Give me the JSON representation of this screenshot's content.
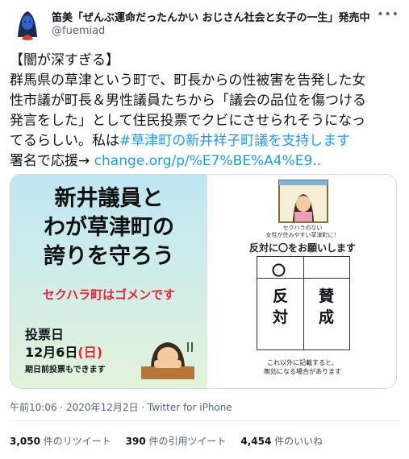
{
  "author": {
    "display_name": "笛美「ぜんぶ運命だったんかい おじさん社会と女子の一生」発売中",
    "handle": "@fuemiad"
  },
  "tweet": {
    "lines": [
      "【闇が深すぎる】",
      "群馬県の草津という町で、町長からの性被害を告発した女",
      "性市議が町長＆男性議員たちから「議会の品位を傷つける",
      "発言をした」として住民投票でクビにさせられそうになっ",
      "てるらしい。私は"
    ],
    "hashtag": "#草津町の新井祥子町議を支持します",
    "sign_prefix": "署名で応援→ ",
    "link": "change.org/p/%E7%BE%A4%E9.."
  },
  "media": {
    "left": {
      "title_1": "新井議員と",
      "title_2": "わが草津町の",
      "title_3": "誇りを守ろう",
      "subtitle": "セクハラ町はゴメンです",
      "vote_label": "投票日",
      "vote_date_prefix": "12月6日",
      "vote_date_day": "(日)",
      "early_vote": "期日前投票もできます"
    },
    "right": {
      "caption_1": "セクハラのない",
      "caption_2": "女性が住みやすい草津町に！",
      "heading": "反対に〇をお願いします",
      "circle": "〇",
      "col_against": "反対",
      "col_for": "賛成",
      "footer_1": "これ以外に記載すると、",
      "footer_2": "無効になる場合があります"
    }
  },
  "meta": {
    "timestamp": "午前10:06 · 2020年12月2日 · Twitter for iPhone"
  },
  "stats": {
    "retweets_count": "3,050",
    "retweets_label": "件のリツイート",
    "quotes_count": "390",
    "quotes_label": "件の引用ツイート",
    "likes_count": "4,454",
    "likes_label": "件のいいね"
  },
  "colors": {
    "link": "#1d9bf0",
    "accent_red": "#e8233b"
  }
}
